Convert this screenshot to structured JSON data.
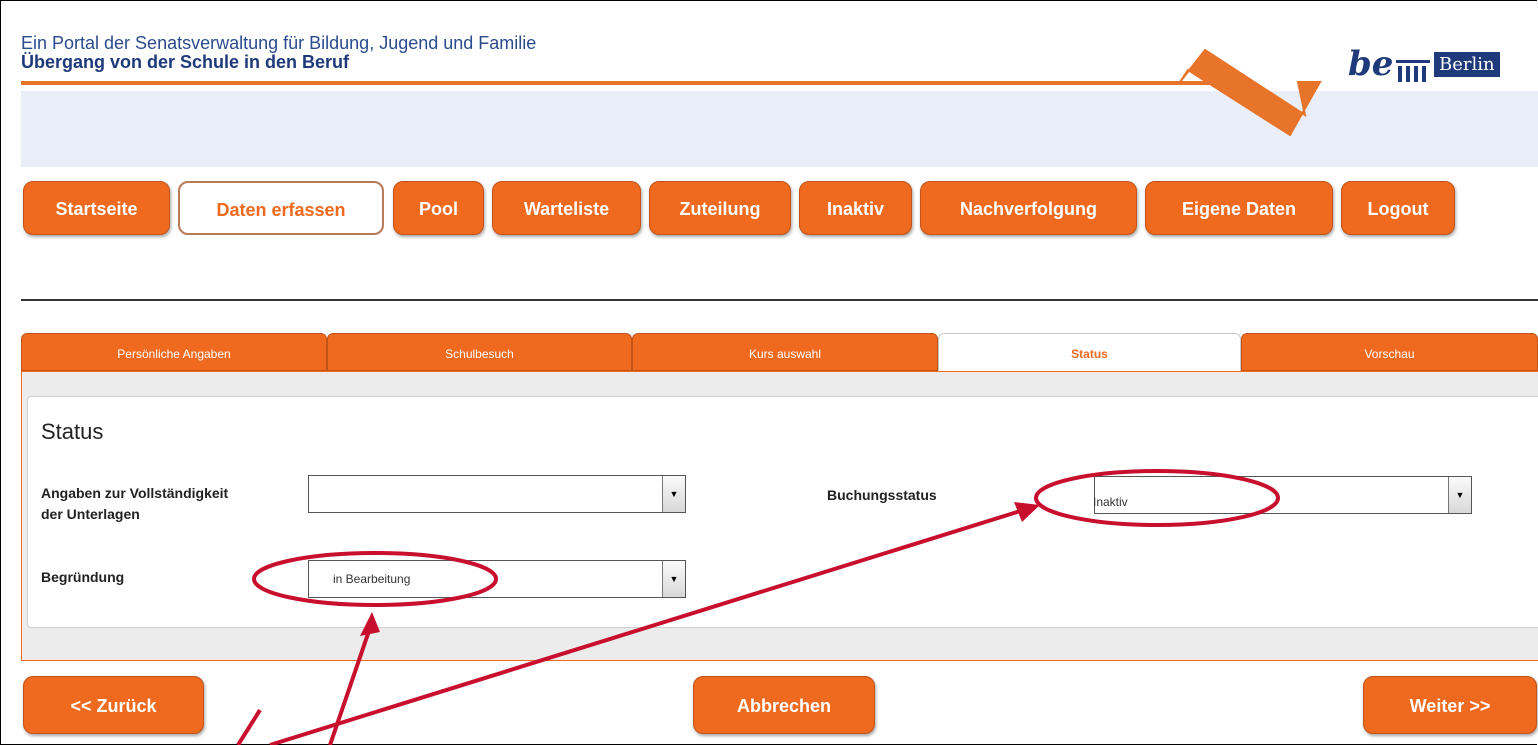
{
  "header": {
    "subtitle": "Ein Portal der Senatsverwaltung für Bildung, Jugend und Familie",
    "title": "Übergang von der Schule in den Beruf",
    "logo_be": "be",
    "logo_berlin": "Berlin"
  },
  "nav": {
    "items": [
      {
        "label": "Startseite"
      },
      {
        "label": "Daten erfassen",
        "active": true
      },
      {
        "label": "Pool"
      },
      {
        "label": "Warteliste"
      },
      {
        "label": "Zuteilung"
      },
      {
        "label": "Inaktiv"
      },
      {
        "label": "Nachverfolgung"
      },
      {
        "label": "Eigene Daten"
      },
      {
        "label": "Logout"
      }
    ]
  },
  "tabs": [
    {
      "label": "Persönliche Angaben"
    },
    {
      "label": "Schulbesuch"
    },
    {
      "label": "Kurs auswahl"
    },
    {
      "label": "Status",
      "active": true
    },
    {
      "label": "Vorschau"
    }
  ],
  "form": {
    "title": "Status",
    "completeness_label_line1": "Angaben zur Vollständigkeit",
    "completeness_label_line2": "der Unterlagen",
    "completeness_value": "",
    "reason_label": "Begründung",
    "reason_value": "in Bearbeitung",
    "booking_label": "Buchungsstatus",
    "booking_value": "Inaktiv"
  },
  "footer": {
    "back_label": "<< Zurück",
    "cancel_label": "Abbrechen",
    "next_label": "Weiter >>"
  },
  "colors": {
    "accent": "#ef6a1f",
    "brand_blue": "#1f3a7a",
    "annotation": "#c8102e"
  },
  "icons": [
    "dropdown-arrow-icon",
    "annotation-arrow",
    "annotation-circle"
  ]
}
